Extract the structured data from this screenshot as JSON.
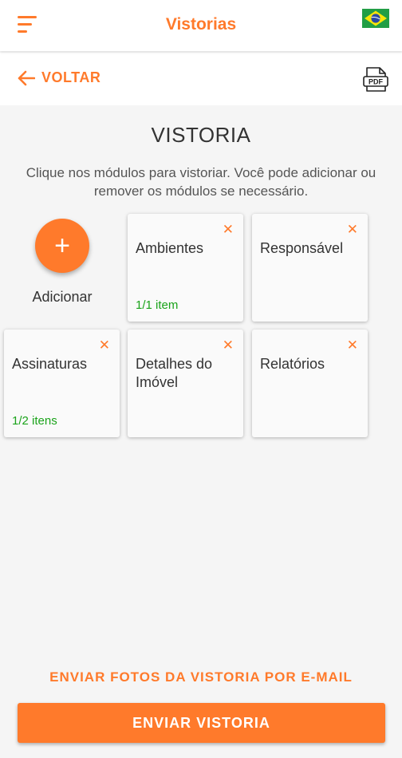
{
  "appbar": {
    "title": "Vistorias",
    "language_icon": "brazil-flag-icon",
    "menu_icon": "menu-icon"
  },
  "subbar": {
    "back_label": "VOLTAR",
    "back_icon": "arrow-left-icon",
    "pdf_icon": "pdf-file-icon",
    "pdf_text": "PDF"
  },
  "main": {
    "title": "VISTORIA",
    "instructions": "Clique nos módulos para vistoriar. Você pode adicionar ou remover os módulos se necessário.",
    "add": {
      "icon_glyph": "+",
      "label": "Adicionar"
    },
    "modules": [
      {
        "name": "Ambientes",
        "count": "1/1 item"
      },
      {
        "name": "Responsável",
        "count": ""
      },
      {
        "name": "Assinaturas",
        "count": "1/2 itens"
      },
      {
        "name": "Detalhes do Imóvel",
        "count": ""
      },
      {
        "name": "Relatórios",
        "count": ""
      }
    ],
    "remove_glyph": "✕"
  },
  "footer": {
    "email_link": "ENVIAR FOTOS DA VISTORIA POR E-MAIL",
    "submit_label": "ENVIAR VISTORIA"
  },
  "colors": {
    "accent": "#ff7a2b",
    "success": "#1aa31a",
    "background": "#f5f5f5"
  }
}
